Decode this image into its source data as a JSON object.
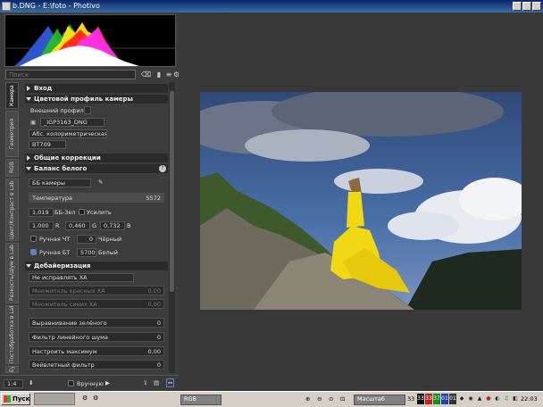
{
  "window": {
    "title": "b.DNG - E:\\foto - Photivo"
  },
  "search": {
    "placeholder": "Поиск"
  },
  "tabs": [
    "Камера",
    "Геометрия",
    "RGB",
    "Цвет/Контраст в Lab",
    "Резкость/Шум в Lab",
    "Постобработка в Lab",
    "Eyecandy"
  ],
  "sections": {
    "input": "Вход",
    "camera_profile": "Цветовой профиль камеры",
    "general": "Общие коррекции",
    "wb": "Баланс белого",
    "demosaic": "Дебайеризация"
  },
  "profile": {
    "external_label": "Внешний профиль",
    "file": "_IGP3163_DNG",
    "intent": "Абс. колориметрическая",
    "gamma": "BT709"
  },
  "wb": {
    "mode": "ББ камеры",
    "temperature_label": "Температура",
    "temperature_value": "5572",
    "green_value": "1,019",
    "green_label": "ББ-Зел",
    "boost_label": "Усилить",
    "r_value": "1,000",
    "r_label": "R",
    "g_value": "0,460",
    "g_label": "G",
    "b_value": "0,732",
    "b_label": "B",
    "manual_black_label": "Ручная ЧТ",
    "black_value": "0",
    "black_label": "Чёрный",
    "manual_white_label": "Ручная БТ",
    "white_value": "5700",
    "white_label": "Белый"
  },
  "demosaic": {
    "ca_mode": "Не исправлять ХА",
    "red_mult_label": "Множитель красных ХА",
    "red_mult_value": "0,00",
    "blue_mult_label": "Множитель синих ХА",
    "blue_mult_value": "0,00",
    "green_eq_label": "Выравнивание зелёного",
    "green_eq_value": "0",
    "line_noise_label": "Фильтр линейного шума",
    "line_noise_value": "0",
    "max_label": "Настроить максимум",
    "max_value": "0,00",
    "wavelet_label": "Вейвлетный фильтр",
    "wavelet_value": "0"
  },
  "bottom": {
    "zoom": "1:4",
    "manual_label": "Вручную"
  },
  "status": {
    "color_mode": "RGB",
    "scale_label": "Масштаб",
    "scale_value": "33"
  },
  "taskbar": {
    "start": "Пуск",
    "clock": "22:03",
    "tray_numbers": [
      "33",
      "33",
      "37",
      "01",
      "01"
    ]
  },
  "colors": {
    "accent": "#4b8cd8",
    "panel": "#3c3c3c",
    "viewer": "#383838"
  }
}
